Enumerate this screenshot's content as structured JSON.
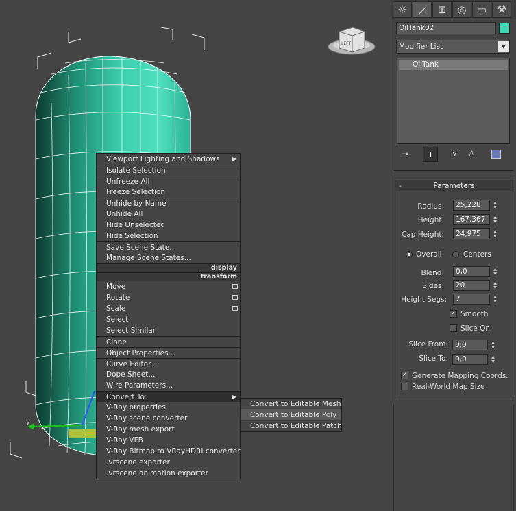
{
  "context_menu": {
    "items_top": [
      {
        "label": "Viewport Lighting and Shadows",
        "submenu": true
      },
      {
        "label": "Isolate Selection",
        "sep": true
      },
      {
        "label": "Unfreeze All",
        "sep": true
      },
      {
        "label": "Freeze Selection"
      },
      {
        "label": "Unhide by Name",
        "sep": true
      },
      {
        "label": "Unhide All"
      },
      {
        "label": "Hide Unselected"
      },
      {
        "label": "Hide Selection"
      },
      {
        "label": "Save Scene State...",
        "sep": true
      },
      {
        "label": "Manage Scene States..."
      }
    ],
    "section_display": "display",
    "section_transform": "transform",
    "items_bottom": [
      {
        "label": "Move",
        "box": true
      },
      {
        "label": "Rotate",
        "box": true
      },
      {
        "label": "Scale",
        "box": true
      },
      {
        "label": "Select"
      },
      {
        "label": "Select Similar"
      },
      {
        "label": "Clone",
        "sep": true
      },
      {
        "label": "Object Properties...",
        "sep": true
      },
      {
        "label": "Curve Editor...",
        "sep": true
      },
      {
        "label": "Dope Sheet..."
      },
      {
        "label": "Wire Parameters..."
      },
      {
        "label": "Convert To:",
        "sep": true,
        "submenu": true,
        "active": true
      },
      {
        "label": "V-Ray properties"
      },
      {
        "label": "V-Ray scene converter"
      },
      {
        "label": "V-Ray mesh export"
      },
      {
        "label": "V-Ray VFB"
      },
      {
        "label": "V-Ray Bitmap to VRayHDRI converter"
      },
      {
        "label": ".vrscene exporter"
      },
      {
        "label": ".vrscene animation exporter"
      }
    ],
    "submenu": [
      {
        "label": "Convert to Editable Mesh"
      },
      {
        "label": "Convert to Editable Poly",
        "highlighted": true
      },
      {
        "label": "Convert to Editable Patch"
      }
    ]
  },
  "panel": {
    "tabs": [
      {
        "icon": "create-icon"
      },
      {
        "icon": "modify-icon"
      },
      {
        "icon": "hierarchy-icon"
      },
      {
        "icon": "motion-icon"
      },
      {
        "icon": "display-icon"
      },
      {
        "icon": "utilities-icon"
      }
    ],
    "object_name": "OilTank02",
    "object_color": "#3fd6b4",
    "modifier_list": "Modifier List",
    "stack": [
      "OilTank"
    ],
    "rollout_title": "Parameters",
    "rollout_toggle": "-",
    "params": {
      "radius_label": "Radius:",
      "radius": "25,228",
      "height_label": "Height:",
      "height": "167,367",
      "cap_height_label": "Cap Height:",
      "cap_height": "24,975",
      "overall_label": "Overall",
      "centers_label": "Centers",
      "blend_label": "Blend:",
      "blend": "0,0",
      "sides_label": "Sides:",
      "sides": "20",
      "height_segs_label": "Height Segs:",
      "height_segs": "7",
      "smooth_label": "Smooth",
      "slice_on_label": "Slice On",
      "slice_from_label": "Slice From:",
      "slice_from": "0,0",
      "slice_to_label": "Slice To:",
      "slice_to": "0,0",
      "gen_mapping_label": "Generate Mapping Coords.",
      "real_world_label": "Real-World Map Size"
    },
    "viewcube_label": "LEFT",
    "axis_y": "y"
  }
}
